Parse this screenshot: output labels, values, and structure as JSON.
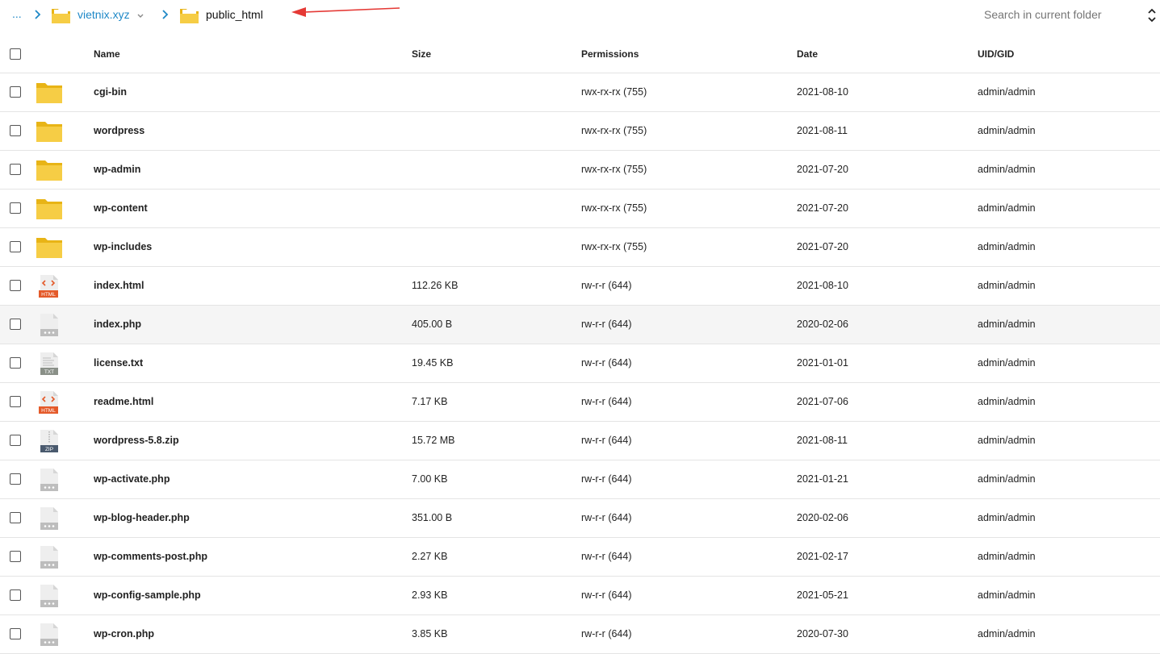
{
  "breadcrumb": {
    "ellipsis": "...",
    "parent": "vietnix.xyz",
    "current": "public_html"
  },
  "search": {
    "placeholder": "Search in current folder"
  },
  "columns": {
    "name": "Name",
    "size": "Size",
    "permissions": "Permissions",
    "date": "Date",
    "uid": "UID/GID"
  },
  "colors": {
    "accent": "#1e88c7",
    "folder": "#f5c518",
    "arrow": "#e53935",
    "html": "#e45a2a",
    "zip": "#4a5a6e"
  },
  "rows": [
    {
      "type": "folder",
      "icon": "folder-icon",
      "name": "cgi-bin",
      "size": "",
      "perm": "rwx-rx-rx (755)",
      "date": "2021-08-10",
      "uid": "admin/admin"
    },
    {
      "type": "folder",
      "icon": "folder-icon",
      "name": "wordpress",
      "size": "",
      "perm": "rwx-rx-rx (755)",
      "date": "2021-08-11",
      "uid": "admin/admin"
    },
    {
      "type": "folder",
      "icon": "folder-icon",
      "name": "wp-admin",
      "size": "",
      "perm": "rwx-rx-rx (755)",
      "date": "2021-07-20",
      "uid": "admin/admin"
    },
    {
      "type": "folder",
      "icon": "folder-icon",
      "name": "wp-content",
      "size": "",
      "perm": "rwx-rx-rx (755)",
      "date": "2021-07-20",
      "uid": "admin/admin"
    },
    {
      "type": "folder",
      "icon": "folder-icon",
      "name": "wp-includes",
      "size": "",
      "perm": "rwx-rx-rx (755)",
      "date": "2021-07-20",
      "uid": "admin/admin"
    },
    {
      "type": "html",
      "icon": "html-file-icon",
      "badge": "HTML",
      "name": "index.html",
      "size": "112.26 KB",
      "perm": "rw-r-r (644)",
      "date": "2021-08-10",
      "uid": "admin/admin"
    },
    {
      "type": "php",
      "icon": "php-file-icon",
      "name": "index.php",
      "size": "405.00 B",
      "perm": "rw-r-r (644)",
      "date": "2020-02-06",
      "uid": "admin/admin",
      "highlight": true
    },
    {
      "type": "txt",
      "icon": "txt-file-icon",
      "badge": "TXT",
      "name": "license.txt",
      "size": "19.45 KB",
      "perm": "rw-r-r (644)",
      "date": "2021-01-01",
      "uid": "admin/admin"
    },
    {
      "type": "html",
      "icon": "html-file-icon",
      "badge": "HTML",
      "name": "readme.html",
      "size": "7.17 KB",
      "perm": "rw-r-r (644)",
      "date": "2021-07-06",
      "uid": "admin/admin"
    },
    {
      "type": "zip",
      "icon": "zip-file-icon",
      "badge": "ZIP",
      "name": "wordpress-5.8.zip",
      "size": "15.72 MB",
      "perm": "rw-r-r (644)",
      "date": "2021-08-11",
      "uid": "admin/admin"
    },
    {
      "type": "php",
      "icon": "php-file-icon",
      "name": "wp-activate.php",
      "size": "7.00 KB",
      "perm": "rw-r-r (644)",
      "date": "2021-01-21",
      "uid": "admin/admin"
    },
    {
      "type": "php",
      "icon": "php-file-icon",
      "name": "wp-blog-header.php",
      "size": "351.00 B",
      "perm": "rw-r-r (644)",
      "date": "2020-02-06",
      "uid": "admin/admin"
    },
    {
      "type": "php",
      "icon": "php-file-icon",
      "name": "wp-comments-post.php",
      "size": "2.27 KB",
      "perm": "rw-r-r (644)",
      "date": "2021-02-17",
      "uid": "admin/admin"
    },
    {
      "type": "php",
      "icon": "php-file-icon",
      "name": "wp-config-sample.php",
      "size": "2.93 KB",
      "perm": "rw-r-r (644)",
      "date": "2021-05-21",
      "uid": "admin/admin"
    },
    {
      "type": "php",
      "icon": "php-file-icon",
      "name": "wp-cron.php",
      "size": "3.85 KB",
      "perm": "rw-r-r (644)",
      "date": "2020-07-30",
      "uid": "admin/admin"
    }
  ]
}
